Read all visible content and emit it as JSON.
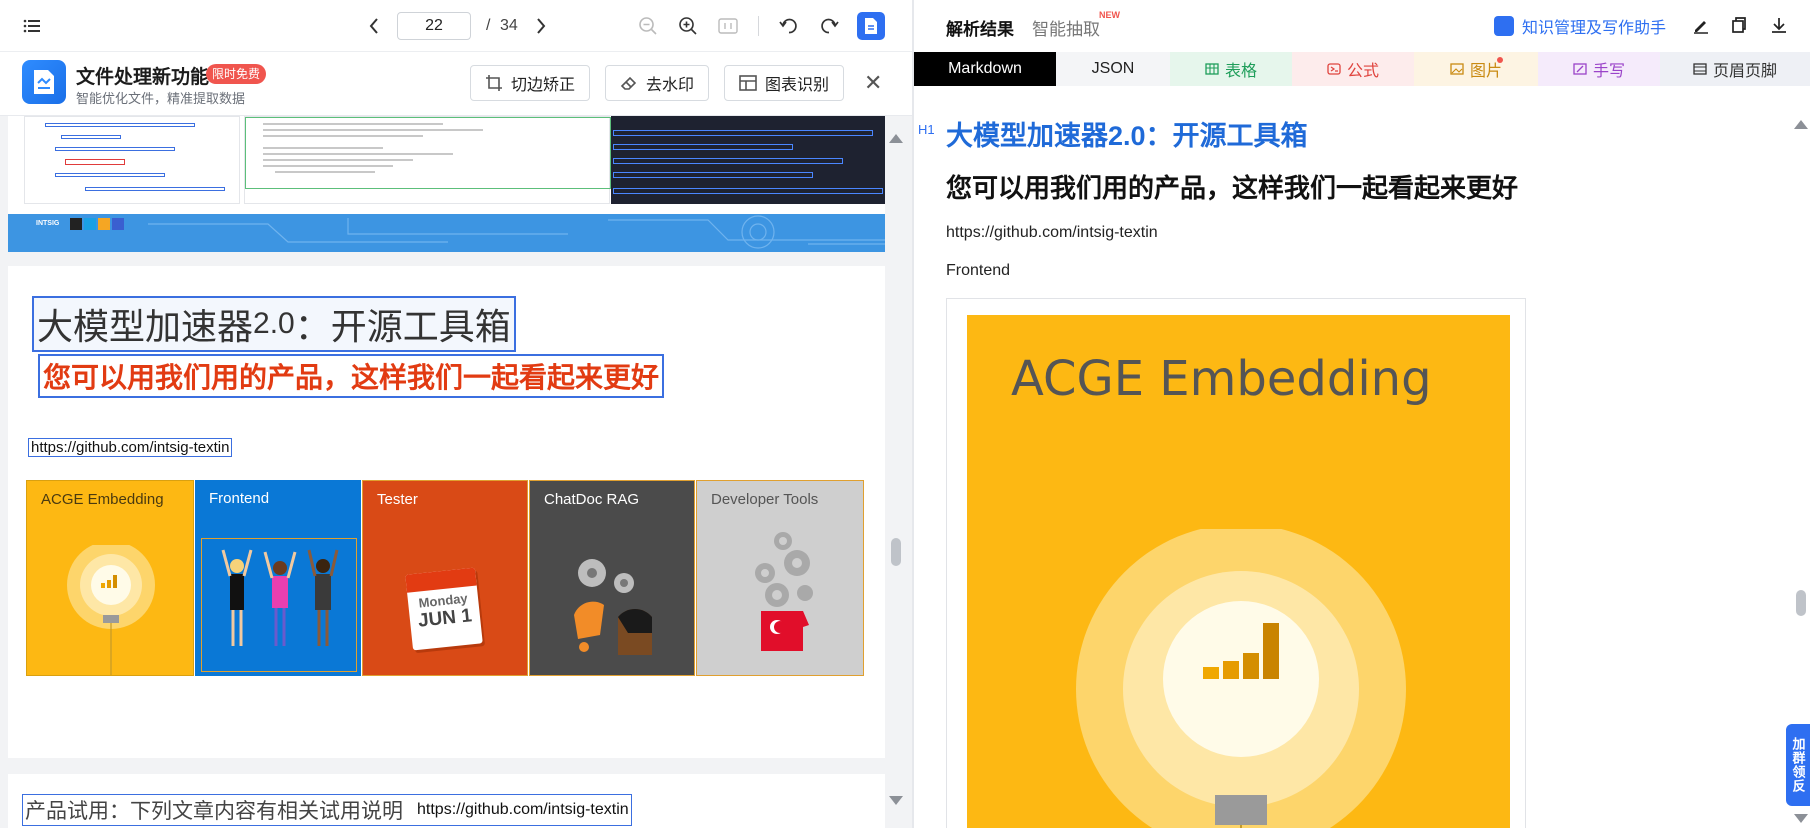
{
  "toolbar": {
    "current_page": "22",
    "page_separator": "/",
    "total_pages": "34"
  },
  "banner": {
    "title": "文件处理新功能",
    "badge": "限时免费",
    "subtitle": "智能优化文件，精准提取数据",
    "buttons": [
      "切边矫正",
      "去水印",
      "图表识别"
    ]
  },
  "document": {
    "title_main": "大模型加速器",
    "title_version": "2.0",
    "title_rest": "：开源工具箱",
    "subtitle": "您可以用我们用的产品，这样我们一起看起来更好",
    "link": "https://github.com/intsig-textin",
    "tiles": [
      "ACGE Embedding",
      "Frontend",
      "Tester",
      "ChatDoc RAG",
      "Developer Tools"
    ],
    "calendar_day": "Monday",
    "calendar_date": "JUN 1",
    "page3_text": "产品试用：下列文章内容有相关试用说明",
    "page3_link": "https://github.com/intsig-textin",
    "footer_brand": "INTSIG"
  },
  "right": {
    "tab_active": "解析结果",
    "tab_other": "智能抽取",
    "new_label": "NEW",
    "km_link": "知识管理及写作助手",
    "formats": [
      {
        "label": "Markdown",
        "bg": "#000000",
        "fg": "#ffffff"
      },
      {
        "label": "JSON",
        "bg": "#f4f5f7",
        "fg": "#222222"
      },
      {
        "label": "表格",
        "bg": "#e6f6ec",
        "fg": "#1f9e5a"
      },
      {
        "label": "公式",
        "bg": "#fdecec",
        "fg": "#e0443e"
      },
      {
        "label": "图片",
        "bg": "#fdf4e3",
        "fg": "#c98a12"
      },
      {
        "label": "手写",
        "bg": "#f5ebfb",
        "fg": "#9b44c9"
      },
      {
        "label": "页眉页脚",
        "bg": "#eef0f5",
        "fg": "#333333"
      }
    ],
    "h1_tag": "H1",
    "h1": "大模型加速器2.0：开源工具箱",
    "h2": "您可以用我们用的产品，这样我们一起看起来更好",
    "p1": "https://github.com/intsig-textin",
    "p2": "Frontend",
    "image_title": "ACGE Embedding",
    "float_tab": "加群领反"
  },
  "colors": {
    "accent_blue": "#2e6ff1",
    "tile_acge": "#fdb813",
    "tile_frontend": "#0a78d6",
    "tile_tester": "#d94a16",
    "tile_chatdoc": "#4b4b4b",
    "tile_devtools": "#cfcfcf",
    "footer_blue": "#3d95e2"
  }
}
